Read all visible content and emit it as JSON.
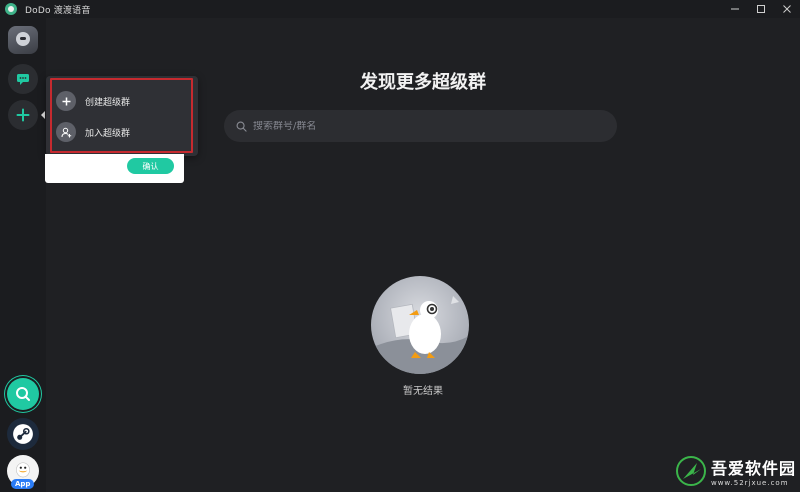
{
  "window": {
    "title": "DoDo 渡渡语音",
    "controls": [
      "minimize-icon",
      "maximize-icon",
      "close-icon"
    ]
  },
  "main": {
    "title": "发现更多超级群",
    "search": {
      "placeholder": "搜索群号/群名",
      "value": ""
    },
    "empty_state": {
      "text": "暂无结果"
    }
  },
  "popup_menu": {
    "items": [
      {
        "label": "创建超级群",
        "icon": "plus-icon"
      },
      {
        "label": "加入超级群",
        "icon": "user-add-icon"
      }
    ],
    "confirm_label": "确认"
  },
  "rail": {
    "app_badge": "App"
  },
  "watermark": {
    "title": "吾爱软件园",
    "url": "www.52rjxue.com"
  },
  "colors": {
    "accent": "#20c9a2",
    "background": "#1f2023",
    "highlight_border": "#c62a2f"
  }
}
